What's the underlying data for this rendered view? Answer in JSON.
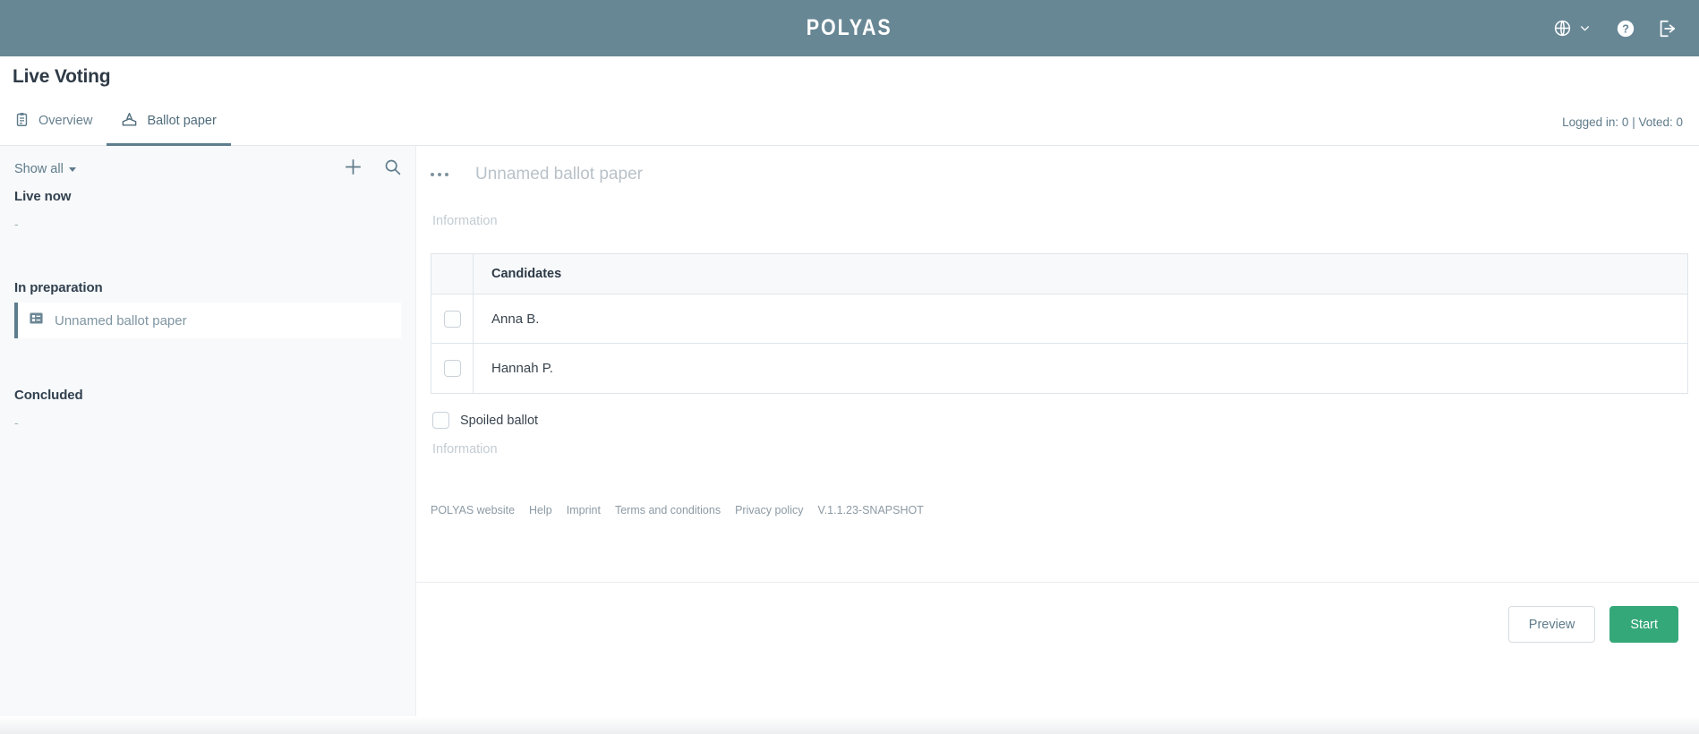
{
  "topbar": {
    "brand": "POLYAS",
    "language_icon": "globe-icon",
    "language_caret": "chevron-down-icon",
    "help_icon": "help-circle-icon",
    "logout_icon": "logout-icon"
  },
  "page": {
    "title": "Live Voting"
  },
  "tabs": [
    {
      "label": "Overview",
      "icon": "clipboard-icon",
      "active": false
    },
    {
      "label": "Ballot paper",
      "icon": "ballot-box-icon",
      "active": true
    }
  ],
  "stats": {
    "text": "Logged in: 0 | Voted: 0"
  },
  "sidebar": {
    "filter_label": "Show all",
    "add_icon": "plus-icon",
    "search_icon": "search-icon",
    "sections": [
      {
        "title": "Live now",
        "empty": "-",
        "items": []
      },
      {
        "title": "In preparation",
        "empty": "",
        "items": [
          {
            "label": "Unnamed ballot paper",
            "icon": "ballot-list-icon",
            "selected": true
          }
        ]
      },
      {
        "title": "Concluded",
        "empty": "-",
        "items": []
      }
    ]
  },
  "ballot": {
    "menu_icon": "more-options-icon",
    "title_value": "",
    "title_placeholder": "Unnamed ballot paper",
    "info_value": "",
    "info_placeholder": "Information",
    "table": {
      "columns": [
        "",
        "Candidates"
      ],
      "rows": [
        {
          "name": "Anna B.",
          "checked": false
        },
        {
          "name": "Hannah P.",
          "checked": false
        }
      ]
    },
    "spoiled": {
      "label": "Spoiled ballot",
      "checked": false
    },
    "bottom_info_value": "",
    "bottom_info_placeholder": "Information"
  },
  "footer": {
    "links": [
      "POLYAS website",
      "Help",
      "Imprint",
      "Terms and conditions",
      "Privacy policy"
    ],
    "version": "V.1.1.23-SNAPSHOT"
  },
  "actions": {
    "preview_label": "Preview",
    "start_label": "Start"
  },
  "colors": {
    "brand_bar": "#678795",
    "accent": "#5d7d8d",
    "primary_button": "#35a879",
    "sidebar_bg": "#f7f9fb"
  }
}
